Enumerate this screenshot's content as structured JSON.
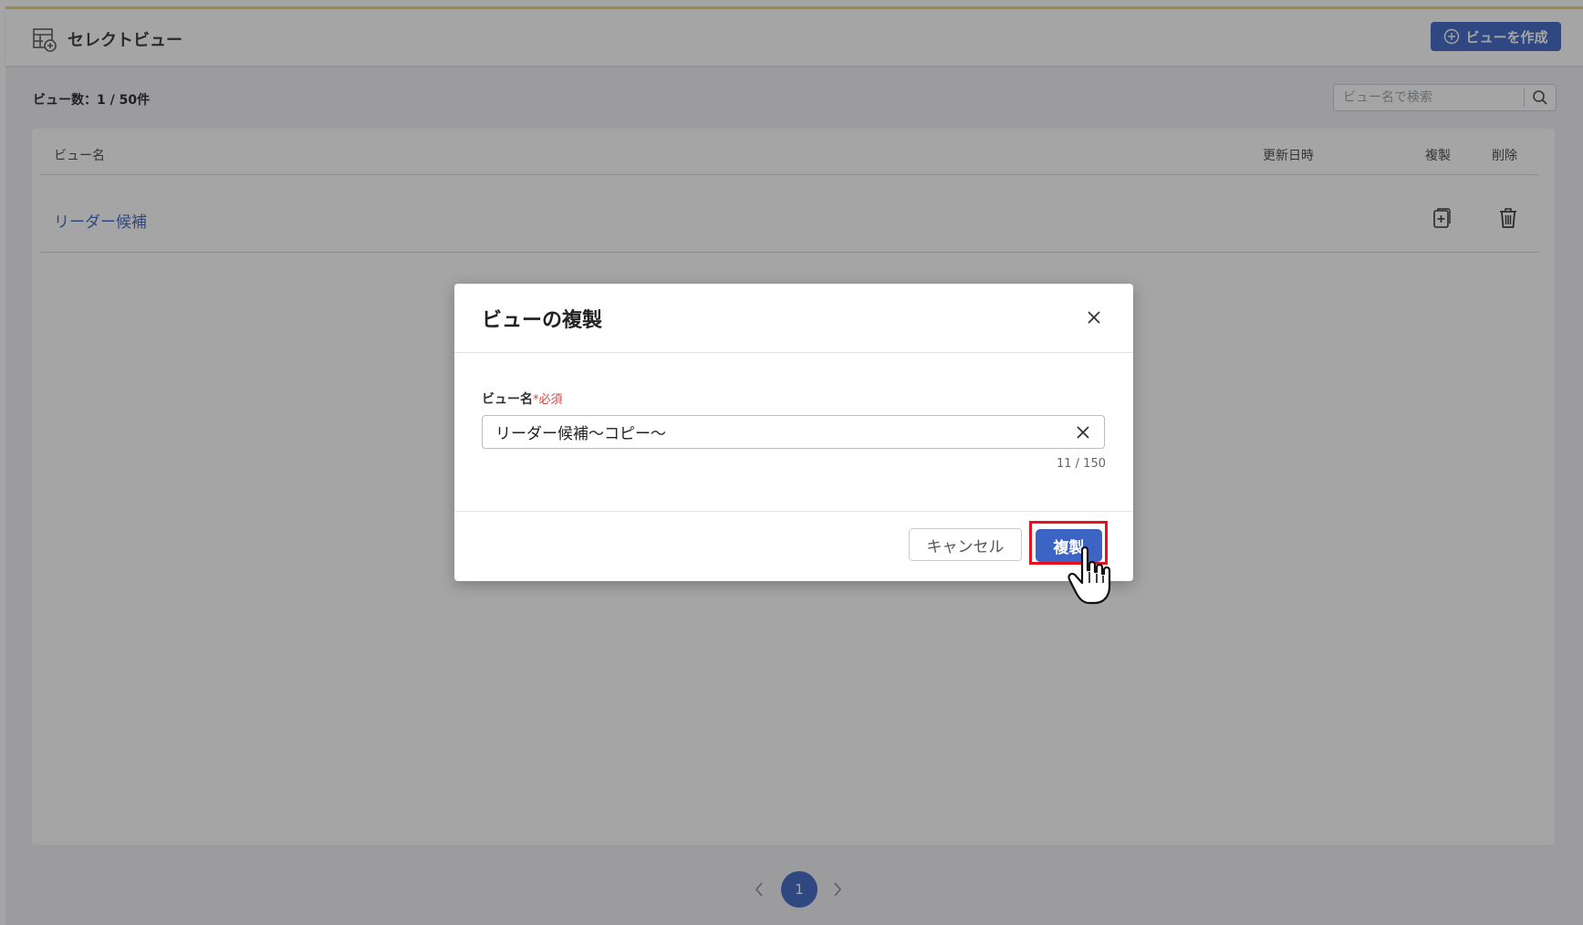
{
  "header": {
    "title": "セレクトビュー",
    "create_button": "ビューを作成"
  },
  "toolbar": {
    "count": "ビュー数：1 / 50件",
    "search_placeholder": "ビュー名で検索"
  },
  "table": {
    "columns": [
      "ビュー名",
      "更新日時",
      "複製",
      "削除"
    ],
    "rows": [
      {
        "name": "リーダー候補",
        "updated": ""
      }
    ]
  },
  "pagination": {
    "current": "1"
  },
  "modal": {
    "title": "ビューの複製",
    "field_label": "ビュー名",
    "required": "*必須",
    "value": "リーダー候補〜コピー〜",
    "char_count": "11 / 150",
    "cancel": "キャンセル",
    "confirm": "複製"
  },
  "colors": {
    "accent": "#3b64c4",
    "header_line": "#e9d36e",
    "highlight": "#e8121c",
    "required": "#d64343"
  },
  "icons": [
    "table-view-icon",
    "plus-circle-icon",
    "search-icon",
    "copy-icon",
    "trash-icon",
    "chevron-left-icon",
    "chevron-right-icon",
    "close-icon",
    "clear-icon",
    "hand-cursor-icon"
  ]
}
